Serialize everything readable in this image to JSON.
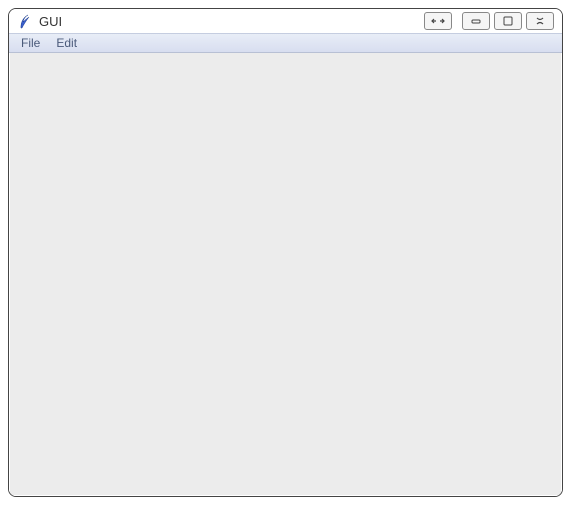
{
  "window": {
    "title": "GUI"
  },
  "menubar": {
    "items": [
      "File",
      "Edit"
    ]
  }
}
